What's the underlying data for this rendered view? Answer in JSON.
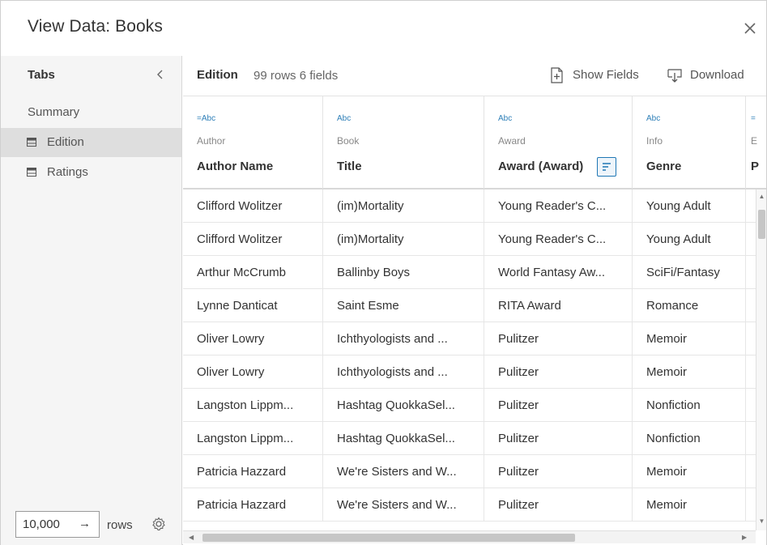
{
  "dialog": {
    "title": "View Data: Books",
    "close_icon": "close-icon"
  },
  "sidebar": {
    "header": "Tabs",
    "items": [
      {
        "label": "Summary",
        "icon": ""
      },
      {
        "label": "Edition",
        "icon": "table-icon",
        "active": true
      },
      {
        "label": "Ratings",
        "icon": "table-icon"
      }
    ],
    "rows_value": "10,000",
    "rows_arrow": "→",
    "rows_label": "rows"
  },
  "toolbar": {
    "table_name": "Edition",
    "meta": "99 rows 6 fields",
    "show_fields": "Show Fields",
    "download": "Download"
  },
  "columns": [
    {
      "type": "=Abc",
      "source": "Author",
      "name": "Author Name"
    },
    {
      "type": "Abc",
      "source": "Book",
      "name": "Title"
    },
    {
      "type": "Abc",
      "source": "Award",
      "name": "Award (Award)"
    },
    {
      "type": "Abc",
      "source": "Info",
      "name": "Genre"
    },
    {
      "type": "=",
      "source": "E",
      "name": "P"
    }
  ],
  "rows": [
    [
      "Clifford Wolitzer",
      "(im)Mortality",
      "Young Reader's C...",
      "Young Adult"
    ],
    [
      "Clifford Wolitzer",
      "(im)Mortality",
      "Young Reader's C...",
      "Young Adult"
    ],
    [
      "Arthur McCrumb",
      "Ballinby Boys",
      "World Fantasy Aw...",
      "SciFi/Fantasy"
    ],
    [
      "Lynne Danticat",
      "Saint Esme",
      "RITA Award",
      "Romance"
    ],
    [
      "Oliver Lowry",
      "Ichthyologists and ...",
      "Pulitzer",
      "Memoir"
    ],
    [
      "Oliver Lowry",
      "Ichthyologists and ...",
      "Pulitzer",
      "Memoir"
    ],
    [
      "Langston Lippm...",
      "Hashtag QuokkaSel...",
      "Pulitzer",
      "Nonfiction"
    ],
    [
      "Langston Lippm...",
      "Hashtag QuokkaSel...",
      "Pulitzer",
      "Nonfiction"
    ],
    [
      "Patricia Hazzard",
      "We're Sisters and W...",
      "Pulitzer",
      "Memoir"
    ],
    [
      "Patricia Hazzard",
      "We're Sisters and W...",
      "Pulitzer",
      "Memoir"
    ]
  ],
  "colors": {
    "accent": "#1f77b4",
    "type_label": "#2e7fb8",
    "sidebar_bg": "#f5f5f5",
    "active_item": "#dedede"
  }
}
